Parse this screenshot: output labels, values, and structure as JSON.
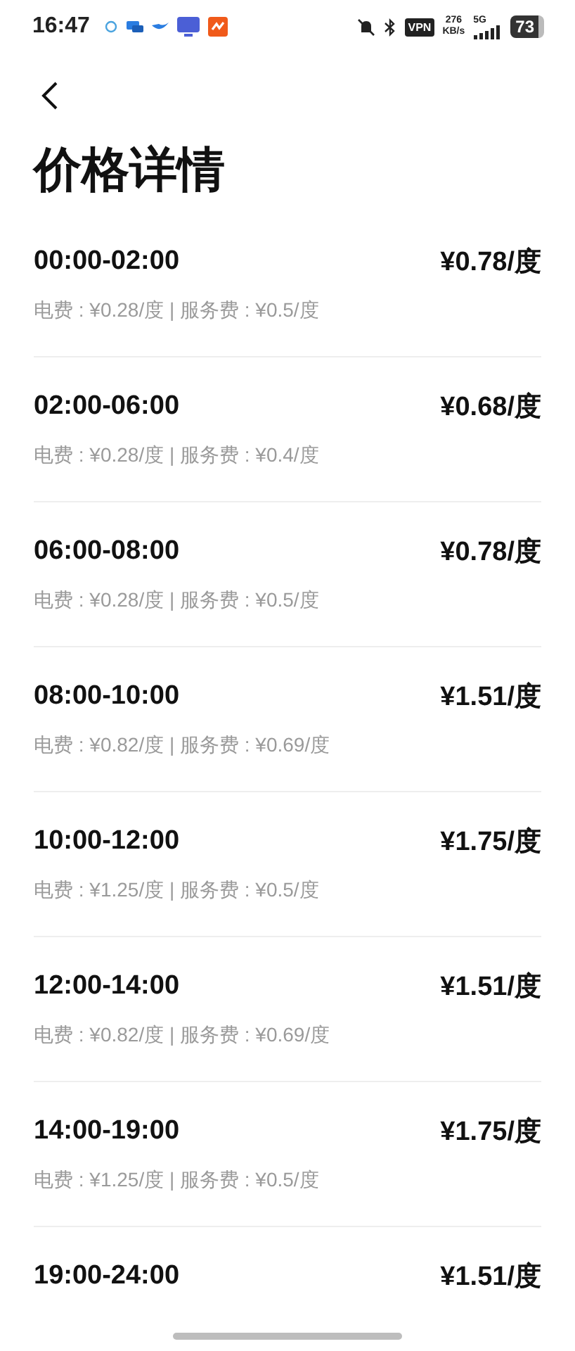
{
  "status_bar": {
    "time": "16:47",
    "vpn": "VPN",
    "speed_value": "276",
    "speed_unit": "KB/s",
    "network": "5G",
    "battery": "73"
  },
  "page": {
    "title": "价格详情"
  },
  "prices": [
    {
      "time": "00:00-02:00",
      "price": "¥0.78/度",
      "detail": "电费 : ¥0.28/度 | 服务费 : ¥0.5/度"
    },
    {
      "time": "02:00-06:00",
      "price": "¥0.68/度",
      "detail": "电费 : ¥0.28/度 | 服务费 : ¥0.4/度"
    },
    {
      "time": "06:00-08:00",
      "price": "¥0.78/度",
      "detail": "电费 : ¥0.28/度 | 服务费 : ¥0.5/度"
    },
    {
      "time": "08:00-10:00",
      "price": "¥1.51/度",
      "detail": "电费 : ¥0.82/度 | 服务费 : ¥0.69/度"
    },
    {
      "time": "10:00-12:00",
      "price": "¥1.75/度",
      "detail": "电费 : ¥1.25/度 | 服务费 : ¥0.5/度"
    },
    {
      "time": "12:00-14:00",
      "price": "¥1.51/度",
      "detail": "电费 : ¥0.82/度 | 服务费 : ¥0.69/度"
    },
    {
      "time": "14:00-19:00",
      "price": "¥1.75/度",
      "detail": "电费 : ¥1.25/度 | 服务费 : ¥0.5/度"
    },
    {
      "time": "19:00-24:00",
      "price": "¥1.51/度"
    }
  ]
}
